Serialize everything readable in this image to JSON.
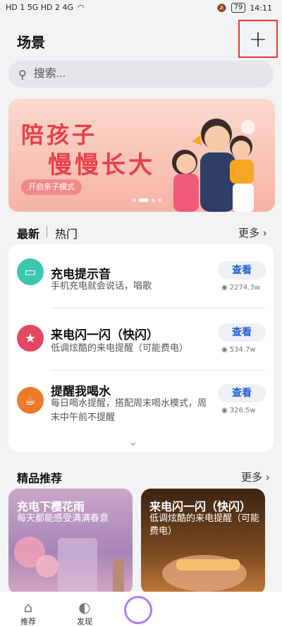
{
  "status": {
    "signal": "HD 1 5G  HD 2 4G",
    "battery": "79",
    "time": "14:11"
  },
  "header": {
    "title": "场景",
    "add_icon": "plus-icon"
  },
  "search": {
    "placeholder": "搜索..."
  },
  "banner": {
    "line1": "陪孩子",
    "line2": "慢慢长大",
    "button": "开启亲子模式"
  },
  "tabs": {
    "latest": "最新",
    "hot": "热门",
    "more": "更多"
  },
  "list": [
    {
      "name": "充电提示音",
      "desc": "手机充电就会说话，唱歌",
      "action": "查看",
      "views": "2274.3w",
      "color": "#3cc6b1",
      "icon": "battery-icon"
    },
    {
      "name": "来电闪一闪（快闪）",
      "desc": "低调炫酷的来电提醒（可能费电）",
      "action": "查看",
      "views": "534.7w",
      "color": "#e34761",
      "icon": "star-icon"
    },
    {
      "name": "提醒我喝水",
      "desc": "每日喝水提醒，搭配周末喝水模式，周末中午前不提醒",
      "action": "查看",
      "views": "326.5w",
      "color": "#ec7a2a",
      "icon": "cup-icon"
    }
  ],
  "featured": {
    "title": "精品推荐",
    "more": "更多"
  },
  "cards": [
    {
      "title": "充电下樱花雨",
      "desc": "每天都能感受满满春意"
    },
    {
      "title": "来电闪一闪（快闪）",
      "desc": "低调炫酷的来电提醒（可能费电）"
    }
  ],
  "nav": {
    "recommend": "推荐",
    "discover": "发现"
  }
}
